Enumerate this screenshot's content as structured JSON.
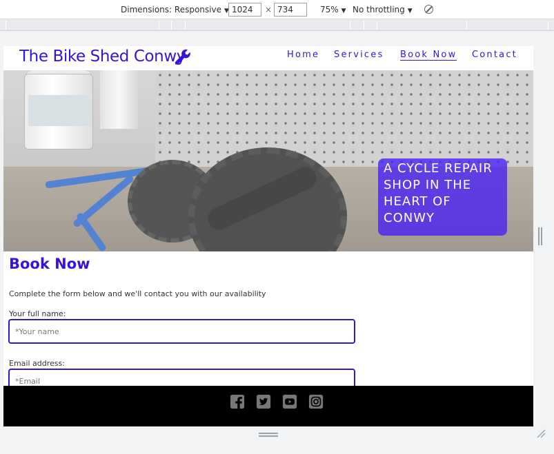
{
  "devtools": {
    "dimensions_label": "Dimensions: Responsive",
    "width_value": "1024",
    "height_value": "734",
    "times": "×",
    "zoom": "75%",
    "throttling": "No throttling"
  },
  "site": {
    "brand": "The Bike Shed Conwy",
    "nav": {
      "home": "Home",
      "services": "Services",
      "book_now": "Book Now",
      "contact": "Contact"
    },
    "tagline": "A CYCLE REPAIR SHOP IN THE HEART OF CONWY",
    "page_title": "Book Now",
    "intro": "Complete the form below and we'll contact you with our availability",
    "form": {
      "name_label": "Your full name:",
      "name_placeholder": "*Your name",
      "email_label": "Email address:",
      "email_placeholder": "*Email"
    },
    "social": [
      "facebook-icon",
      "twitter-icon",
      "youtube-icon",
      "instagram-icon"
    ]
  },
  "colors": {
    "brand": "#3a12d6",
    "tagline_bg": "#461ef5",
    "footer_bg": "#000000",
    "social_icon": "#777777"
  }
}
